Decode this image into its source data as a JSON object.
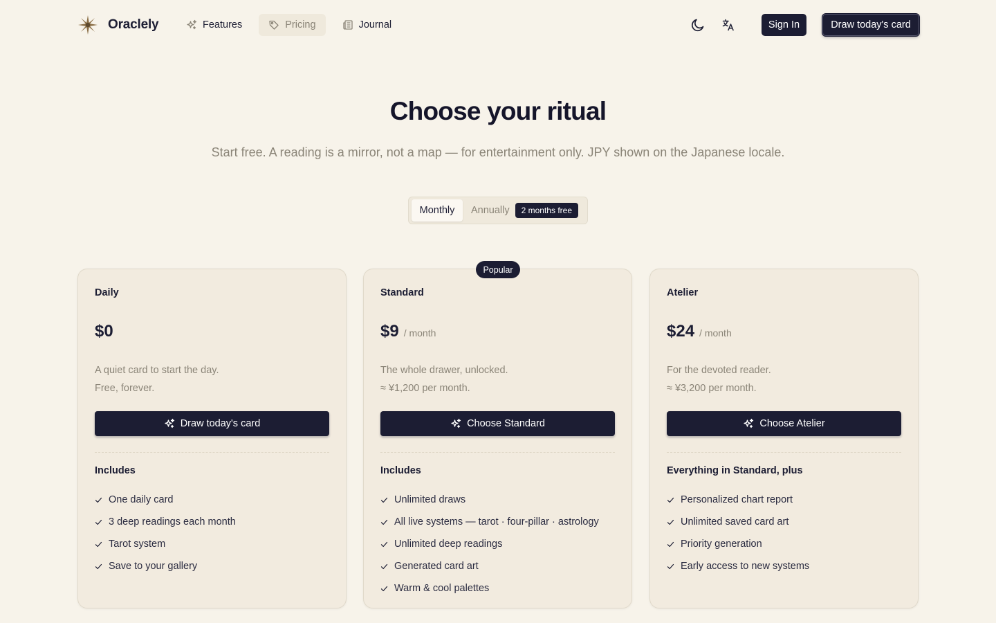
{
  "brand": {
    "name": "Oraclely"
  },
  "nav": [
    {
      "label": "Features",
      "icon": "sparkles-icon",
      "active": false
    },
    {
      "label": "Pricing",
      "icon": "tag-icon",
      "active": true
    },
    {
      "label": "Journal",
      "icon": "newspaper-icon",
      "active": false
    }
  ],
  "header": {
    "theme_icon": "moon-icon",
    "language_icon": "translate-icon",
    "sign_in_label": "Sign In",
    "cta_label": "Draw today's card"
  },
  "hero": {
    "title": "Choose your ritual",
    "subtitle": "Start free. A reading is a mirror, not a map — for entertainment only. JPY shown on the Japanese locale."
  },
  "billing_toggle": {
    "monthly_label": "Monthly",
    "annually_label": "Annually",
    "badge": "2 months free",
    "selected": "Monthly"
  },
  "plans": [
    {
      "name": "Daily",
      "price": "$0",
      "period": "",
      "description": "A quiet card to start the day.",
      "note": "Free, forever.",
      "button_label": "Draw today's card",
      "includes_title": "Includes",
      "features": [
        "One daily card",
        "3 deep readings each month",
        "Tarot system",
        "Save to your gallery"
      ]
    },
    {
      "name": "Standard",
      "badge": "Popular",
      "price": "$9",
      "period": "/ month",
      "description": "The whole drawer, unlocked.",
      "note": "≈ ¥1,200 per month.",
      "button_label": "Choose Standard",
      "includes_title": "Includes",
      "features": [
        "Unlimited draws",
        "All live systems — tarot · four-pillar · astrology",
        "Unlimited deep readings",
        "Generated card art",
        "Warm & cool palettes"
      ]
    },
    {
      "name": "Atelier",
      "price": "$24",
      "period": "/ month",
      "description": "For the devoted reader.",
      "note": "≈ ¥3,200 per month.",
      "button_label": "Choose Atelier",
      "includes_title": "Everything in Standard, plus",
      "features": [
        "Personalized chart report",
        "Unlimited saved card art",
        "Priority generation",
        "Early access to new systems"
      ]
    }
  ],
  "colors": {
    "background": "#f7f3ea",
    "card": "#f2ebdf",
    "ink": "#1c1d33",
    "muted": "#8a8477",
    "logo": "#8b6f47"
  }
}
